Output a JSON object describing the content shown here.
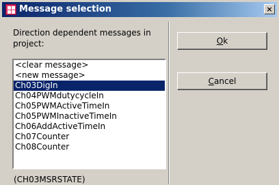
{
  "window": {
    "title": "Message selection"
  },
  "prompt": {
    "line1": "Direction dependent messages in",
    "line2": "project:"
  },
  "messages": [
    "<clear message>",
    "<new message>",
    "Ch03DigIn",
    "Ch04PWMdutycycleIn",
    "Ch05PWMActiveTimeIn",
    "Ch05PWMInactiveTimeIn",
    "Ch06AddActiveTimeIn",
    "Ch07Counter",
    "Ch08Counter"
  ],
  "selected_index": 2,
  "status": "(CH03MSRSTATE)",
  "buttons": {
    "ok_accel": "O",
    "ok_rest": "k",
    "cancel_accel": "C",
    "cancel_rest": "ancel",
    "close": "×"
  },
  "colors": {
    "selection": "#0a246a",
    "face": "#d4d0c8",
    "titlebar_start": "#0a246a"
  }
}
